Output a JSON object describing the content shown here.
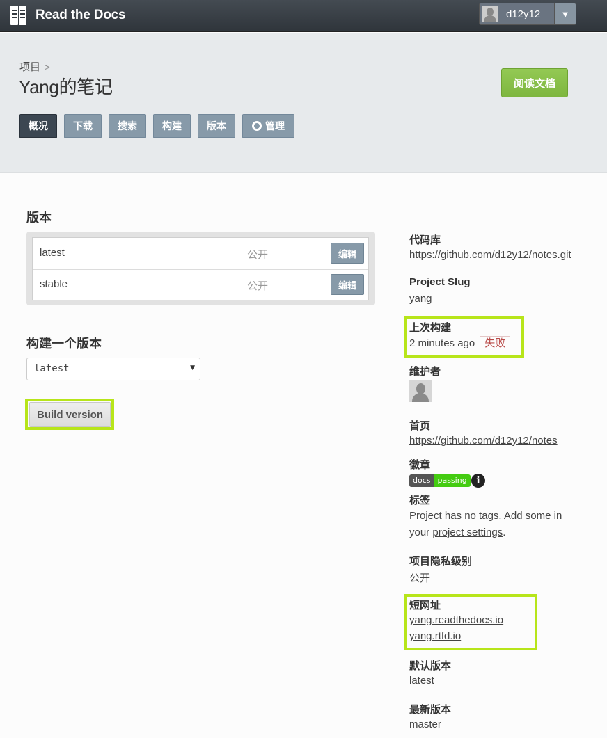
{
  "topnav": {
    "brand": "Read the Docs",
    "username": "d12y12",
    "dropdown_glyph": "▼"
  },
  "header": {
    "breadcrumb": "项目",
    "breadcrumb_sep": ">",
    "title": "Yang的笔记",
    "read_docs_label": "阅读文档",
    "tabs": [
      {
        "label": "概况",
        "active": true
      },
      {
        "label": "下载"
      },
      {
        "label": "搜索"
      },
      {
        "label": "构建"
      },
      {
        "label": "版本"
      },
      {
        "label": "管理",
        "icon": "gear-icon"
      }
    ]
  },
  "versions": {
    "heading": "版本",
    "rows": [
      {
        "name": "latest",
        "privacy": "公开",
        "edit_label": "编辑"
      },
      {
        "name": "stable",
        "privacy": "公开",
        "edit_label": "编辑"
      }
    ]
  },
  "build": {
    "heading": "构建一个版本",
    "selected": "latest",
    "button_label": "Build version"
  },
  "sidebar": {
    "repo_label": "代码库",
    "repo_url": "https://github.com/d12y12/notes.git",
    "slug_label": "Project Slug",
    "slug_value": "yang",
    "last_build_label": "上次构建",
    "last_build_time": "2 minutes ago",
    "last_build_status": "失败",
    "maintainers_label": "维护者",
    "homepage_label": "首页",
    "homepage_url": "https://github.com/d12y12/notes",
    "badge_label": "徽章",
    "badge_key": "docs",
    "badge_value": "passing",
    "tags_label": "标签",
    "tags_text_1": "Project has no tags. Add some in",
    "tags_text_2": "your",
    "tags_link": "project settings",
    "tags_text_3": ".",
    "privacy_label": "项目隐私级别",
    "privacy_value": "公开",
    "shorturl_label": "短网址",
    "shorturl_1": "yang.readthedocs.io",
    "shorturl_2": "yang.rtfd.io",
    "default_version_label": "默认版本",
    "default_version_value": "latest",
    "latest_version_label": "最新版本",
    "latest_version_value": "master"
  },
  "colors": {
    "highlight": "#b7e51a",
    "read_docs_green": "#8bc34a",
    "tab_gray": "#879aa9",
    "tab_active": "#3c4752",
    "fail_red": "#b94a48"
  }
}
